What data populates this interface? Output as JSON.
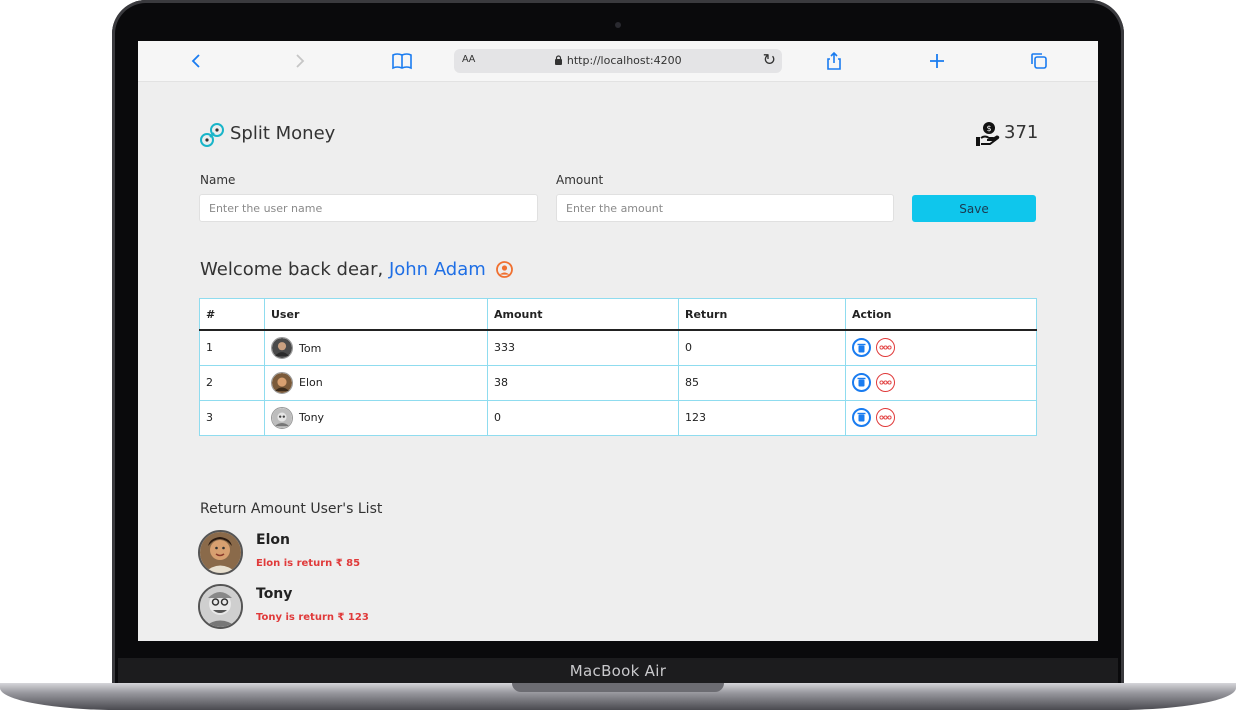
{
  "browser": {
    "url_prefix": "AA",
    "url": "http://localhost:4200",
    "icons": [
      "back-icon",
      "forward-icon",
      "bookmarks-icon",
      "lock-icon",
      "reload-icon",
      "share-icon",
      "new-tab-icon",
      "tabs-icon"
    ]
  },
  "device": {
    "brand_label": "MacBook Air"
  },
  "app": {
    "title": "Split Money",
    "balance": "371",
    "accent": "#0fc6ec",
    "link_color": "#1f6fe5",
    "danger_color": "#e03a3a"
  },
  "form": {
    "name_label": "Name",
    "name_placeholder": "Enter the user name",
    "amount_label": "Amount",
    "amount_placeholder": "Enter the amount",
    "save_label": "Save"
  },
  "welcome": {
    "greeting": "Welcome back dear,",
    "user_name": "John Adam"
  },
  "table": {
    "headers": [
      "#",
      "User",
      "Amount",
      "Return",
      "Action"
    ],
    "rows": [
      {
        "index": "1",
        "user": "Tom",
        "amount": "333",
        "return": "0"
      },
      {
        "index": "2",
        "user": "Elon",
        "amount": "38",
        "return": "85"
      },
      {
        "index": "3",
        "user": "Tony",
        "amount": "0",
        "return": "123"
      }
    ]
  },
  "return_list": {
    "title": "Return Amount User's List",
    "items": [
      {
        "name": "Elon",
        "note": "Elon is return ₹ 85"
      },
      {
        "name": "Tony",
        "note": "Tony is return ₹ 123"
      }
    ]
  }
}
